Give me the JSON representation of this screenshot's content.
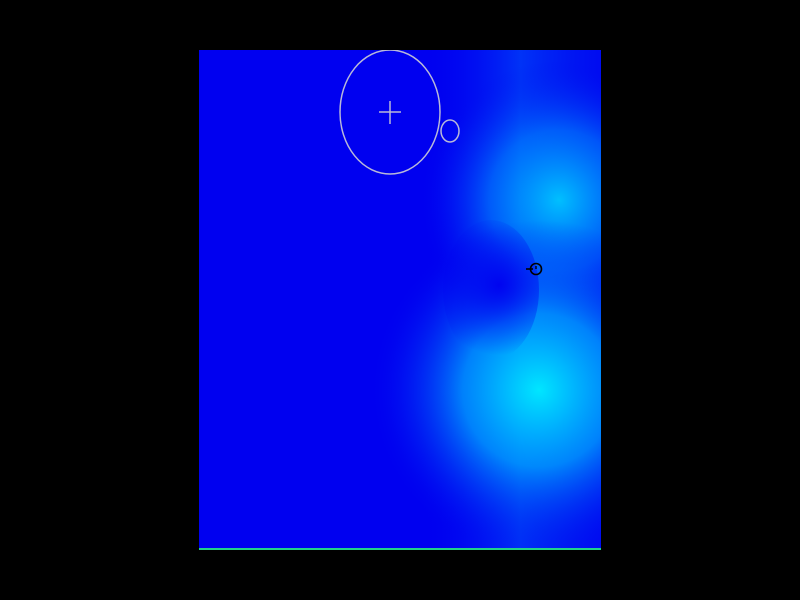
{
  "scene": {
    "background_color": "#000000",
    "field_base_color": "#0000f0",
    "field_glow_color": "#00e6ff",
    "floor_line_color": "#1fd38a",
    "overlay_stroke_color": "#b9b9d8",
    "cursor_color": "#000000"
  },
  "icons": {
    "reticle": "crosshair-reticle-icon",
    "small_ring": "small-ring-icon",
    "pointer": "target-pointer-icon"
  }
}
